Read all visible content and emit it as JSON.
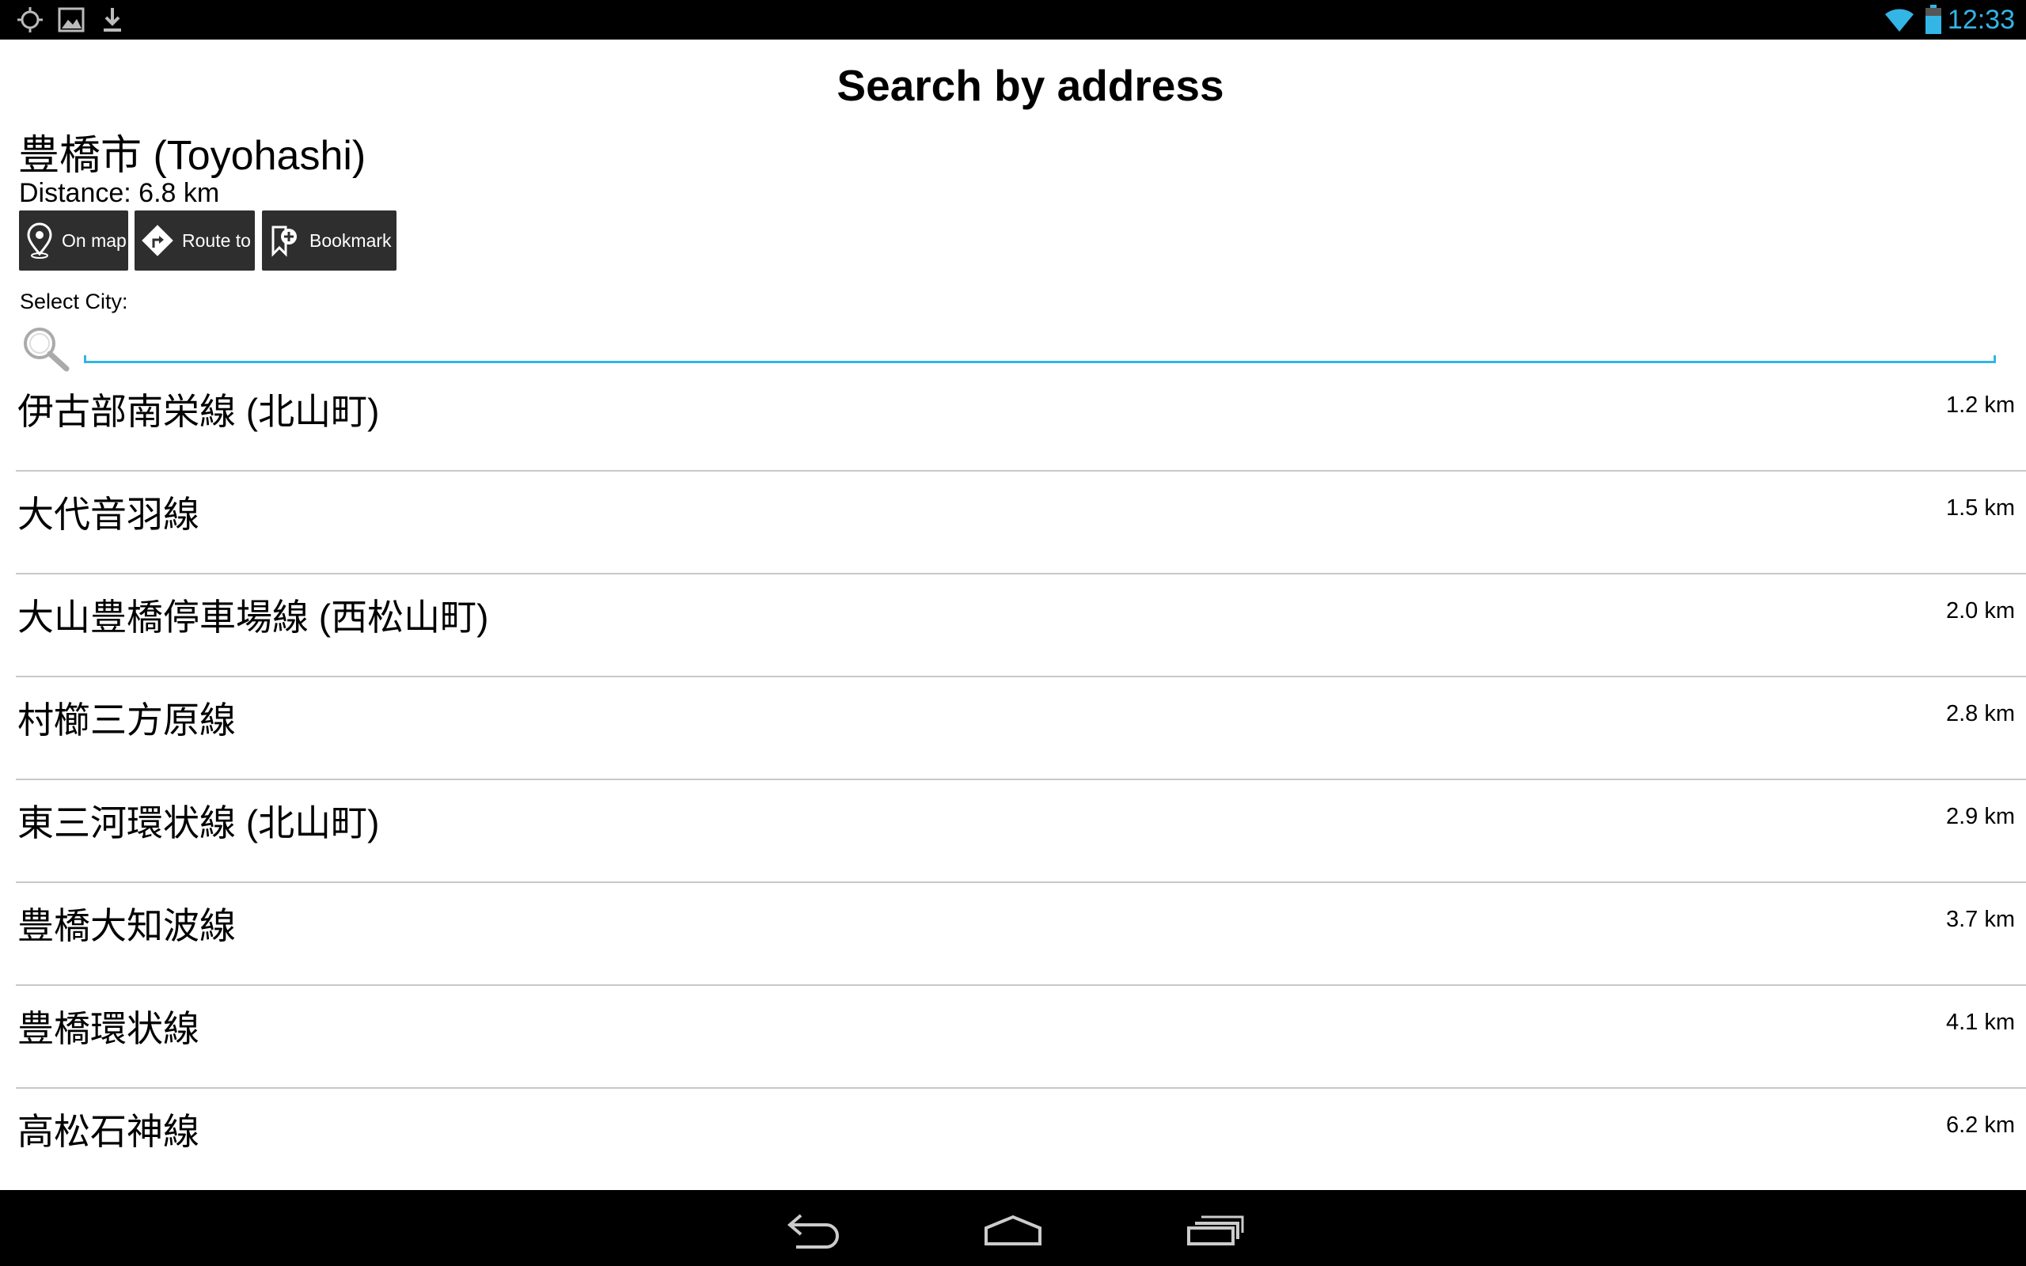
{
  "status": {
    "time": "12:33",
    "accent": "#33b5e5"
  },
  "header": {
    "title": "Search by address"
  },
  "location": {
    "city": "豊橋市 (Toyohashi)",
    "distance": "Distance: 6.8 km"
  },
  "actions": {
    "on_map": "On map",
    "route_to": "Route to",
    "bookmark": "Bookmark"
  },
  "search": {
    "label": "Select City:",
    "value": ""
  },
  "streets": [
    {
      "name": "伊古部南栄線 (北山町)",
      "distance": "1.2 km"
    },
    {
      "name": "大代音羽線",
      "distance": "1.5 km"
    },
    {
      "name": "大山豊橋停車場線 (西松山町)",
      "distance": "2.0 km"
    },
    {
      "name": "村櫛三方原線",
      "distance": "2.8 km"
    },
    {
      "name": "東三河環状線 (北山町)",
      "distance": "2.9 km"
    },
    {
      "name": "豊橋大知波線",
      "distance": "3.7 km"
    },
    {
      "name": "豊橋環状線",
      "distance": "4.1 km"
    },
    {
      "name": "高松石神線",
      "distance": "6.2 km"
    }
  ],
  "icons": {
    "status_left": [
      "gps-icon",
      "image-icon",
      "download-icon"
    ],
    "status_right": [
      "wifi-icon",
      "battery-icon"
    ],
    "nav": [
      "back-icon",
      "home-icon",
      "recent-apps-icon"
    ]
  }
}
